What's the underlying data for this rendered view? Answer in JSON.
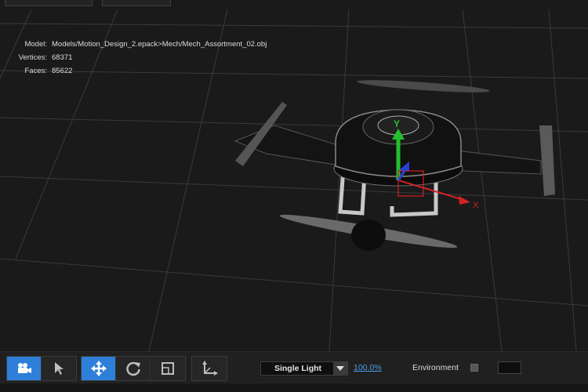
{
  "model_info": {
    "model_label": "Model:",
    "model_value": "Models/Motion_Design_2.epack>Mech/Mech_Assortment_02.obj",
    "vertices_label": "Vertices:",
    "vertices_value": "68371",
    "faces_label": "Faces:",
    "faces_value": "85622"
  },
  "gizmo": {
    "y_label": "Y",
    "x_label": "X",
    "y_color": "#22c02a",
    "x_color": "#d42222",
    "z_color": "#2a3fd8"
  },
  "toolbar": {
    "tools": [
      {
        "icon": "camera-icon",
        "active": true
      },
      {
        "icon": "select-arrow-icon",
        "active": false
      },
      {
        "icon": "move-icon",
        "active": true
      },
      {
        "icon": "rotate-icon",
        "active": false
      },
      {
        "icon": "scale-icon",
        "active": false
      },
      {
        "icon": "axis-icon",
        "active": false
      }
    ],
    "light_mode": "Single Light",
    "zoom": "100.0%",
    "environment_label": "Environment",
    "accent_color": "#2d7fd8"
  }
}
